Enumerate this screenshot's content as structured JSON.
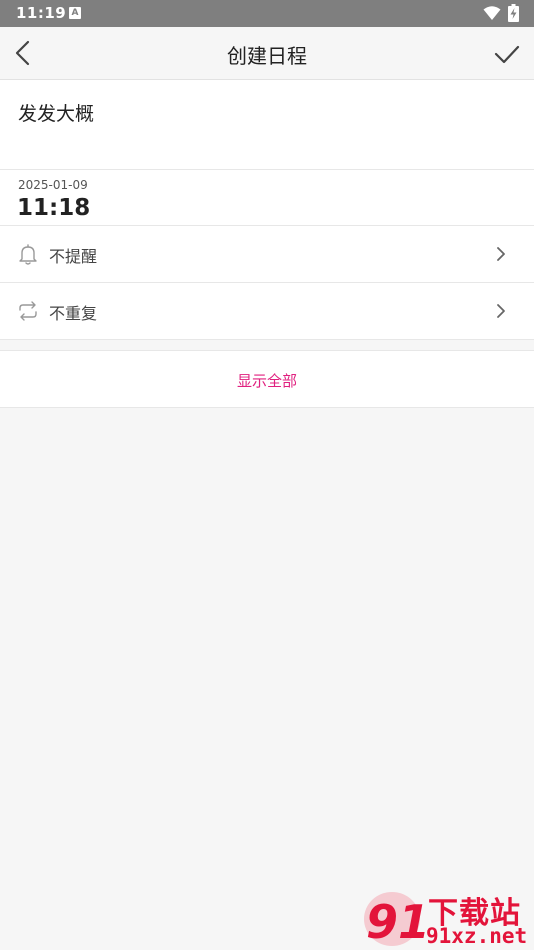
{
  "status_bar": {
    "time": "11:19",
    "notification_icon": "A"
  },
  "header": {
    "title": "创建日程"
  },
  "event": {
    "title": "发发大概",
    "date": "2025-01-09",
    "time": "11:18"
  },
  "options": [
    {
      "label": "不提醒",
      "icon": "bell-icon"
    },
    {
      "label": "不重复",
      "icon": "repeat-icon"
    }
  ],
  "show_all_label": "显示全部",
  "watermark": {
    "logo_text": "91",
    "cn": "下载站",
    "url": "91xz.net"
  },
  "colors": {
    "accent": "#e0207f",
    "watermark": "#e3143a",
    "status_bar": "#7f7f7f"
  }
}
